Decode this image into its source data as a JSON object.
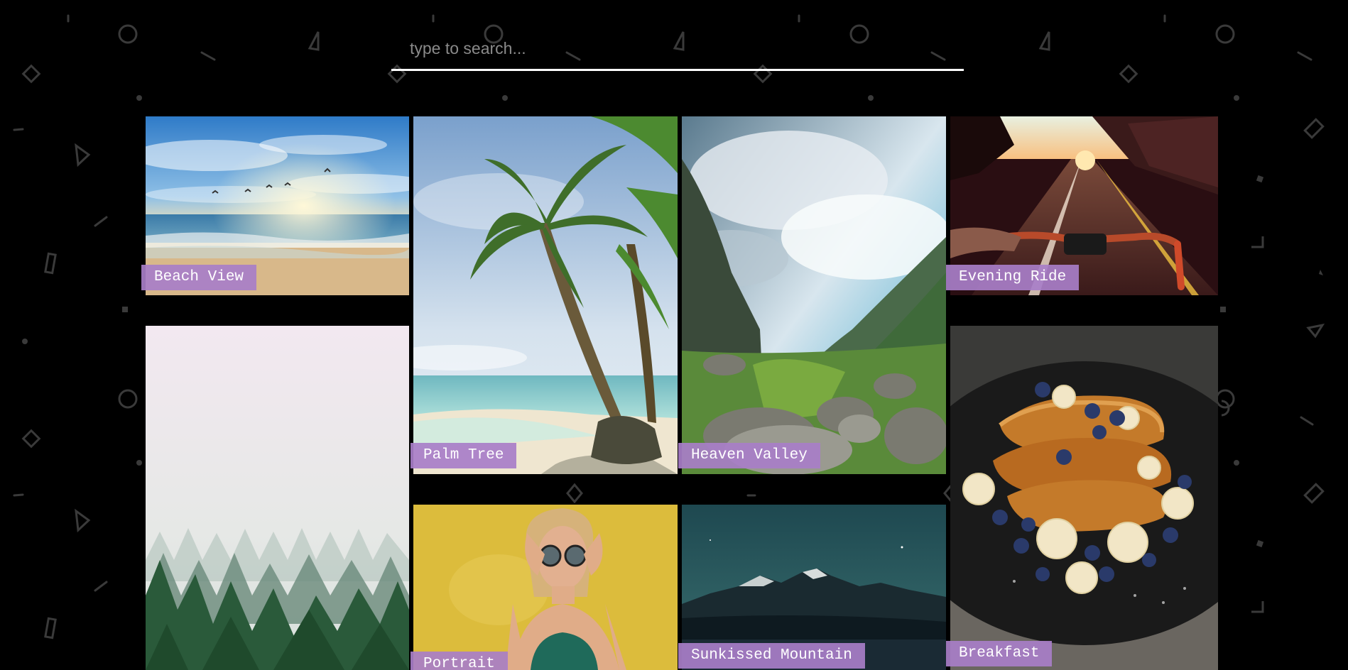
{
  "search": {
    "placeholder": "type to search...",
    "value": ""
  },
  "gallery": {
    "items": [
      {
        "title": "Beach View"
      },
      {
        "title": "Palm Tree"
      },
      {
        "title": "Heaven Valley"
      },
      {
        "title": "Evening Ride"
      },
      {
        "title": ""
      },
      {
        "title": "Portrait"
      },
      {
        "title": "Sunkissed Mountain"
      },
      {
        "title": "Breakfast"
      }
    ]
  },
  "colors": {
    "background": "#000000",
    "label_bg": "#a87ec8",
    "search_underline": "#ffffff",
    "placeholder": "#8a8a8a"
  }
}
